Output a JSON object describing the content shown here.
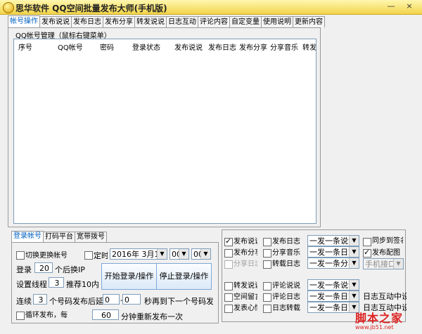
{
  "window": {
    "title": "思华软件 QQ空间批量发布大师(手机版)",
    "minimize": "—",
    "close": "×"
  },
  "tabs": [
    {
      "label": "帐号操作",
      "active": true
    },
    {
      "label": "发布说说"
    },
    {
      "label": "发布日志"
    },
    {
      "label": "发布分享"
    },
    {
      "label": "转发说说"
    },
    {
      "label": "日志互动"
    },
    {
      "label": "评论内容"
    },
    {
      "label": "自定变量"
    },
    {
      "label": "使用说明"
    },
    {
      "label": "更新内容"
    }
  ],
  "account_group": {
    "label": "QQ帐号管理（鼠标右键菜单）",
    "columns": [
      "序号",
      "QQ帐号",
      "密码",
      "登录状态",
      "发布说说",
      "发布日志",
      "发布分享",
      "分享音乐",
      "转发说说",
      "转载日志",
      "分享日志"
    ]
  },
  "sub_tabs": [
    {
      "label": "登录帐号",
      "active": true
    },
    {
      "label": "打码平台"
    },
    {
      "label": "宽带拨号"
    }
  ],
  "login": {
    "cb_switch": "切换更换帐号",
    "cb_timer": "定时",
    "date_value": "2016年 3月1",
    "hour_value": "00",
    "minute_value": "00",
    "login_prefix": "登录",
    "login_count": "20",
    "login_suffix": "个后换IP",
    "threads_prefix": "设置线程",
    "threads_value": "3",
    "threads_suffix": "推荐10内",
    "start_button": "开始登录/操作",
    "stop_button": "停止登录/操作",
    "cont_prefix": "连续",
    "cont_value": "3",
    "cont_mid": "个号码发布后延",
    "delay_from": "0",
    "delay_sep": "—",
    "delay_to": "0",
    "delay_suffix": "秒再到下一个号码发布",
    "loop_label": "循环发布，每",
    "loop_value": "60",
    "loop_suffix": "分钟重新发布一次"
  },
  "options": {
    "row1": [
      {
        "label": "发布说说",
        "checked": true
      },
      {
        "label": "发布日志",
        "checked": false
      }
    ],
    "row2": [
      {
        "label": "发布分享",
        "checked": false
      },
      {
        "label": "分享音乐",
        "checked": false
      }
    ],
    "row3": [
      {
        "label": "分享日志",
        "checked": false,
        "disabled": true
      },
      {
        "label": "转载日志",
        "checked": false
      }
    ],
    "row4": [
      {
        "label": "转发说说",
        "checked": false
      },
      {
        "label": "评论说说",
        "checked": false
      }
    ],
    "row5": [
      {
        "label": "空间留言",
        "checked": false
      },
      {
        "label": "评论日志",
        "checked": false
      }
    ],
    "row6": [
      {
        "label": "发表心情",
        "checked": false
      },
      {
        "label": "日志转载",
        "checked": false
      }
    ],
    "combos_top": [
      "一发一条说说",
      "一发一条日志",
      "一发一条分享"
    ],
    "combos_bottom": [
      "一发一条说说",
      "一发一条日志",
      "一发一条日志"
    ],
    "side_top": [
      {
        "label": "同步到签名",
        "checked": false
      },
      {
        "label": "发布配图",
        "checked": true
      }
    ],
    "phone_combo": "手机接口",
    "diary_interact_1": "日志互动中设置",
    "diary_interact_2": "日志互动中设置"
  },
  "watermark": {
    "text": "脚本之家",
    "url": "www.jb51.net"
  }
}
